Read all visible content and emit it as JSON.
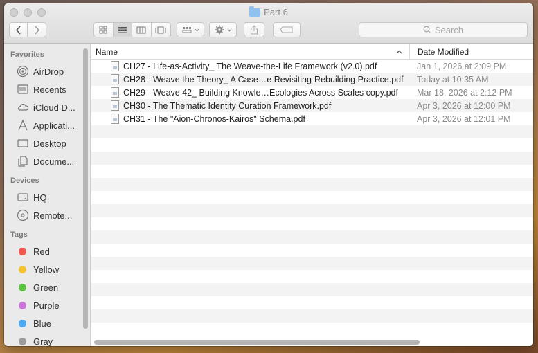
{
  "window": {
    "title": "Part 6"
  },
  "toolbar": {
    "back_icon": "chevron-left-icon",
    "forward_icon": "chevron-right-icon",
    "search_placeholder": "Search"
  },
  "sidebar": {
    "favorites_title": "Favorites",
    "favorites": [
      {
        "label": "AirDrop",
        "icon": "airdrop-icon"
      },
      {
        "label": "Recents",
        "icon": "recents-icon"
      },
      {
        "label": "iCloud D...",
        "icon": "cloud-icon"
      },
      {
        "label": "Applicati...",
        "icon": "applications-icon"
      },
      {
        "label": "Desktop",
        "icon": "desktop-icon"
      },
      {
        "label": "Docume...",
        "icon": "documents-icon"
      }
    ],
    "devices_title": "Devices",
    "devices": [
      {
        "label": "HQ",
        "icon": "hard-drive-icon"
      },
      {
        "label": "Remote...",
        "icon": "disc-icon"
      }
    ],
    "tags_title": "Tags",
    "tags": [
      {
        "label": "Red",
        "color": "#f0584f"
      },
      {
        "label": "Yellow",
        "color": "#f5c431"
      },
      {
        "label": "Green",
        "color": "#5ac141"
      },
      {
        "label": "Purple",
        "color": "#c976d8"
      },
      {
        "label": "Blue",
        "color": "#4aa9f0"
      },
      {
        "label": "Gray",
        "color": "#9b9b9b"
      }
    ]
  },
  "list": {
    "col_name": "Name",
    "col_date": "Date Modified",
    "files": [
      {
        "name": "CH27 - Life-as-Activity_ The Weave-the-Life Framework (v2.0).pdf",
        "date": "Jan 1, 2026 at 2:09 PM"
      },
      {
        "name": "CH28 - Weave the Theory_ A Case…e Revisiting-Rebuilding Practice.pdf",
        "date": "Today at 10:35 AM"
      },
      {
        "name": "CH29 - Weave 42_ Building Knowle…Ecologies Across Scales copy.pdf",
        "date": "Mar 18, 2026 at 2:12 PM"
      },
      {
        "name": "CH30 - The Thematic Identity Curation Framework.pdf",
        "date": "Apr 3, 2026 at 12:00 PM"
      },
      {
        "name": "CH31 - The \"Aion-Chronos-Kairos\" Schema.pdf",
        "date": "Apr 3, 2026 at 12:01 PM"
      }
    ]
  }
}
